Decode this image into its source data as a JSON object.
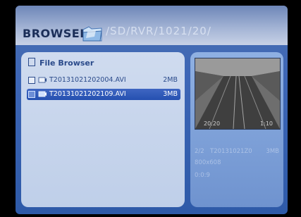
{
  "header": {
    "title": "BROWSER",
    "path": "/SD/RVR/1021/20/"
  },
  "file_browser": {
    "title": "File Browser",
    "files": [
      {
        "name": "T20131021202004.AVI",
        "size": "2MB",
        "selected": false
      },
      {
        "name": "T20131021202109.AVI",
        "size": "3MB",
        "selected": true
      }
    ]
  },
  "preview": {
    "overlay_left": "20:20",
    "overlay_right": "1:10",
    "index": "2/2",
    "filename": "T20131021Z0",
    "size": "3MB",
    "resolution": "800x608",
    "duration": "0:0:9"
  },
  "colors": {
    "header_bg": "#a6b6d6",
    "panel_bg": "#cfdbef",
    "selection": "#2f5ab8",
    "text": "#2a4a8a"
  }
}
